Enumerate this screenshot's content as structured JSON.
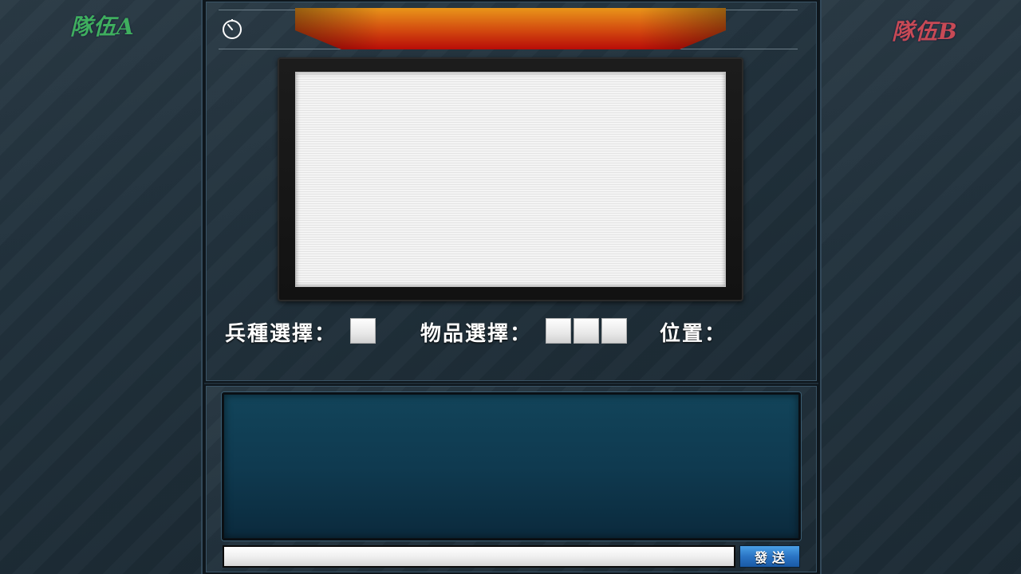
{
  "teams": {
    "a": {
      "name": "隊伍A",
      "color": "#3fae5e"
    },
    "b": {
      "name": "隊伍B",
      "color": "#c74a55"
    }
  },
  "icons": {
    "timer": "stopwatch-icon",
    "banner": "title-banner"
  },
  "selection": {
    "unit_label": "兵種選擇：",
    "item_label": "物品選擇：",
    "position_label": "位置：",
    "unit_slot_count": 1,
    "item_slot_count": 3
  },
  "chat": {
    "input_value": "",
    "send_label": "發送"
  }
}
